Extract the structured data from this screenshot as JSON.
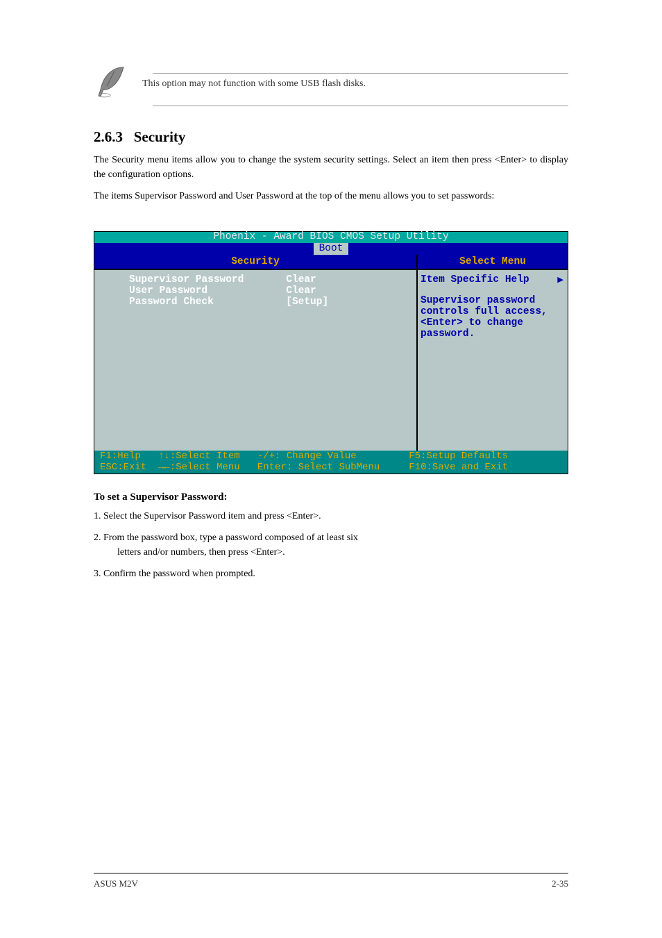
{
  "note": {
    "text": "This option may not function with some USB flash disks."
  },
  "section": {
    "number": "2.6.3",
    "title": "Security"
  },
  "intro1": "The Security menu items allow you to change the system security settings. Select an item then press <Enter> to display the configuration options.",
  "intro2": "The items Supervisor Password and User Password at the top of the menu allows you to set passwords:",
  "bios": {
    "header": "Phoenix - Award BIOS CMOS Setup Utility",
    "tab": "Boot",
    "title_left": "Security",
    "title_right": "Select Menu",
    "items": [
      {
        "label": "Supervisor Password",
        "value": "Clear"
      },
      {
        "label": "User Password",
        "value": "Clear"
      },
      {
        "label": "Password Check",
        "value": "[Setup]"
      }
    ],
    "help_title": "Item Specific Help",
    "help_body": "Supervisor password controls full access, <Enter> to change password.",
    "footer_line1": "F1:Help   ↑↓:Select Item   -/+: Change Value         F5:Setup Defaults",
    "footer_line2": "ESC:Exit  →←:Select Menu   Enter: Select SubMenu     F10:Save and Exit"
  },
  "subsection1": {
    "title": "To set a Supervisor Password:",
    "step1": "1.   Select the Supervisor Password item and press <Enter>.",
    "step2_a": "2.   From the password box, type a password composed of at least six",
    "step2_b": "letters and/or numbers, then press <Enter>.",
    "step3": "3.   Confirm the password when prompted."
  },
  "footer": {
    "left": "ASUS M2V",
    "right": "2-35"
  }
}
